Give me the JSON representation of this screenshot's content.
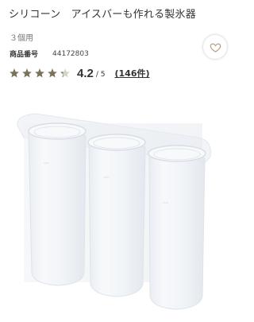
{
  "product": {
    "title": "シリコーン　アイスバーも作れる製氷器",
    "subtitle": "３個用",
    "sku_label": "商品番号",
    "sku_value": "44172803",
    "rating_value": "4.2",
    "rating_max": "/ 5",
    "review_count": "(146件)",
    "rating_fraction": 0.84
  },
  "icons": {
    "favorite": "heart-outline-icon",
    "star": "star-icon"
  },
  "colors": {
    "star_filled": "#7a7258",
    "star_empty": "#d5d2c8",
    "heart": "#b89a7a"
  }
}
